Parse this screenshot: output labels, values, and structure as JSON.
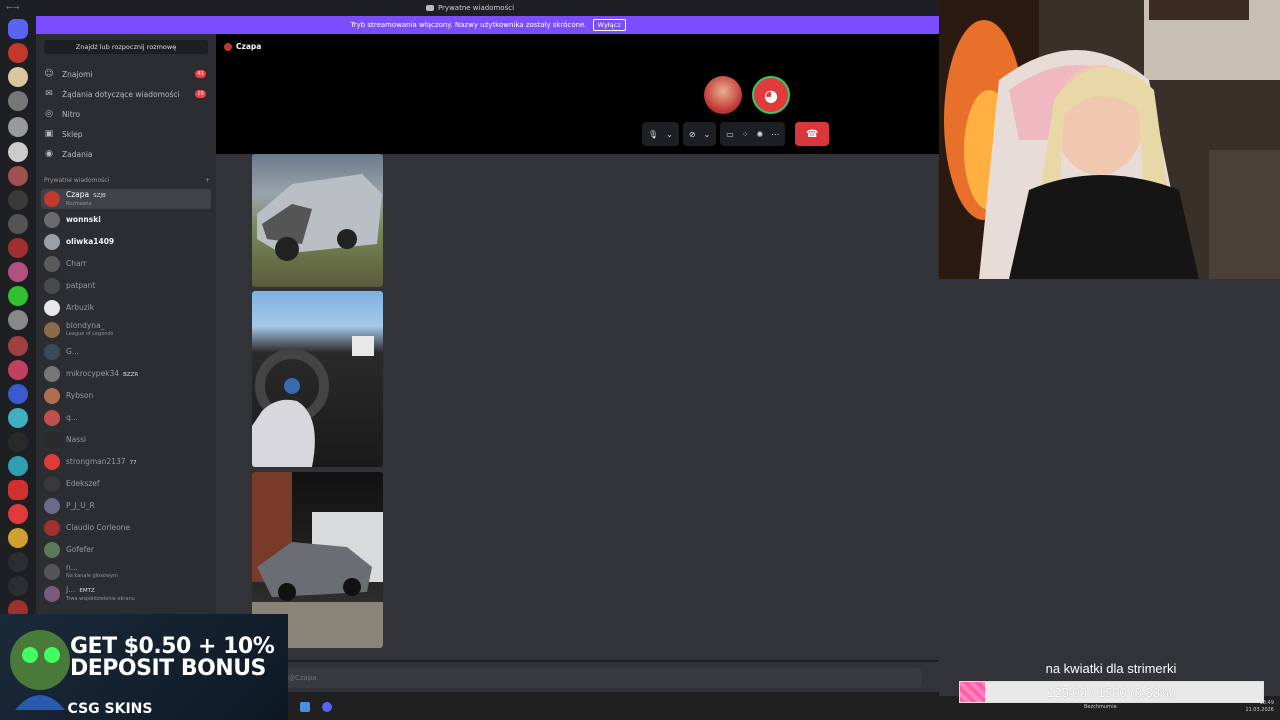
{
  "titlebar": {
    "title": "Prywatne wiadomości"
  },
  "banner": {
    "text": "Tryb streamowania włączony. Nazwy użytkownika zostały skrócone.",
    "button": "Wyłącz"
  },
  "sidebar": {
    "search_placeholder": "Znajdź lub rozpocznij rozmowę",
    "nav": [
      {
        "label": "Znajomi",
        "icon": "friends-icon",
        "count": "41"
      },
      {
        "label": "Żądania dotyczące wiadomości",
        "icon": "mail-icon",
        "count": "16"
      },
      {
        "label": "Nitro",
        "icon": "nitro-icon",
        "count": ""
      },
      {
        "label": "Sklep",
        "icon": "shop-icon",
        "count": ""
      },
      {
        "label": "Zadania",
        "icon": "quests-icon",
        "count": ""
      }
    ],
    "section_title": "Prywatne wiadomości",
    "section_add": "+",
    "dms": [
      {
        "name": "Czapa",
        "sub": "Rozmawia",
        "tag": "SZJB",
        "color": "#c0392b"
      },
      {
        "name": "wonnski",
        "sub": "",
        "tag": "",
        "color": "#6b6b6b"
      },
      {
        "name": "oliwka1409",
        "sub": "",
        "tag": "",
        "color": "#9aa0a6"
      },
      {
        "name": "Charr",
        "sub": "",
        "tag": "",
        "color": "#5a5a5a"
      },
      {
        "name": "patpant",
        "sub": "",
        "tag": "",
        "color": "#4a4a4a"
      },
      {
        "name": "Arbuzik",
        "sub": "",
        "tag": "",
        "color": "#e8e8e8"
      },
      {
        "name": "blondyna_",
        "sub": "League of Legends",
        "tag": "",
        "color": "#8a6b4a"
      },
      {
        "name": "G...",
        "sub": "",
        "tag": "",
        "color": "#3a4a5a"
      },
      {
        "name": "mikrocypek34",
        "sub": "",
        "tag": "BZZR",
        "color": "#777"
      },
      {
        "name": "Rybson",
        "sub": "",
        "tag": "",
        "color": "#b07050"
      },
      {
        "name": "q...",
        "sub": "",
        "tag": "",
        "color": "#c05050"
      },
      {
        "name": "Nassi",
        "sub": "",
        "tag": "",
        "color": "#2a2a2a"
      },
      {
        "name": "strongman2137",
        "sub": "",
        "tag": "77",
        "color": "#e03a3a"
      },
      {
        "name": "Edekszef",
        "sub": "",
        "tag": "",
        "color": "#3a3a3a"
      },
      {
        "name": "P_J_U_R",
        "sub": "",
        "tag": "",
        "color": "#6a6a8a"
      },
      {
        "name": "Claudio Corleone",
        "sub": "",
        "tag": "",
        "color": "#a03030"
      },
      {
        "name": "Gofefer",
        "sub": "",
        "tag": "",
        "color": "#5a7a5a"
      },
      {
        "name": "n...",
        "sub": "Na kanale głosowym",
        "tag": "",
        "color": "#555"
      },
      {
        "name": "J...",
        "sub": "Trwa współdzielenie ekranu",
        "tag": "EMTZ",
        "color": "#7a5a7a"
      }
    ]
  },
  "call": {
    "title": "Czapa"
  },
  "composer": {
    "placeholder": "@Czapa"
  },
  "ad": {
    "headline": "GET $0.50 + 10% DEPOSIT BONUS",
    "brand": "CSG SKINS"
  },
  "goal": {
    "title": "na kwiatki dla strimerki",
    "current": 125.0,
    "target": 1500,
    "percent": 8.33,
    "label": "125.00 / 1500 (8.33%)"
  },
  "taskbar": {
    "weather": "Bezchmurnie",
    "date": "11.03.2026",
    "time": "18:49"
  }
}
